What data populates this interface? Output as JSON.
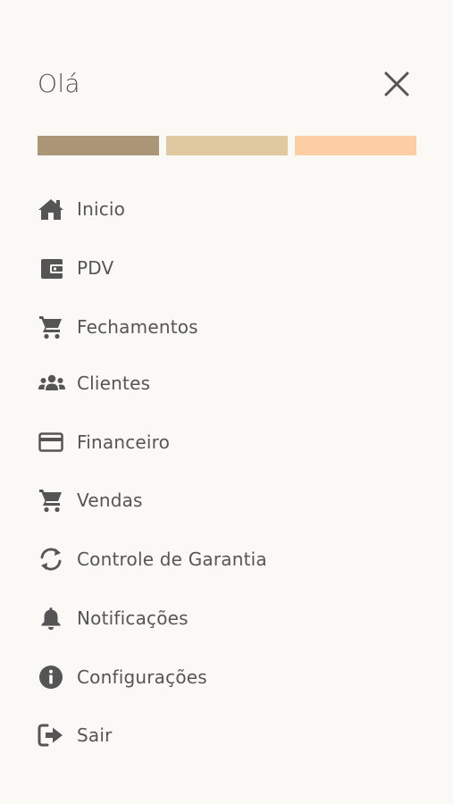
{
  "header": {
    "greeting": "Olá",
    "close_icon": "close-icon"
  },
  "color_bars": [
    "#ab9678",
    "#e0c9a0",
    "#fdcda3"
  ],
  "menu": {
    "items": [
      {
        "label": "Inicio",
        "icon": "home-icon"
      },
      {
        "label": "PDV",
        "icon": "wallet-icon"
      },
      {
        "label": "Fechamentos",
        "icon": "cart-icon"
      },
      {
        "label": "Clientes",
        "icon": "users-icon"
      },
      {
        "label": "Financeiro",
        "icon": "credit-card-icon"
      },
      {
        "label": "Vendas",
        "icon": "cart-icon"
      },
      {
        "label": "Controle de Garantia",
        "icon": "sync-icon"
      },
      {
        "label": "Notificações",
        "icon": "bell-icon"
      },
      {
        "label": "Configurações",
        "icon": "info-icon"
      },
      {
        "label": "Sair",
        "icon": "sign-out-icon"
      }
    ]
  }
}
